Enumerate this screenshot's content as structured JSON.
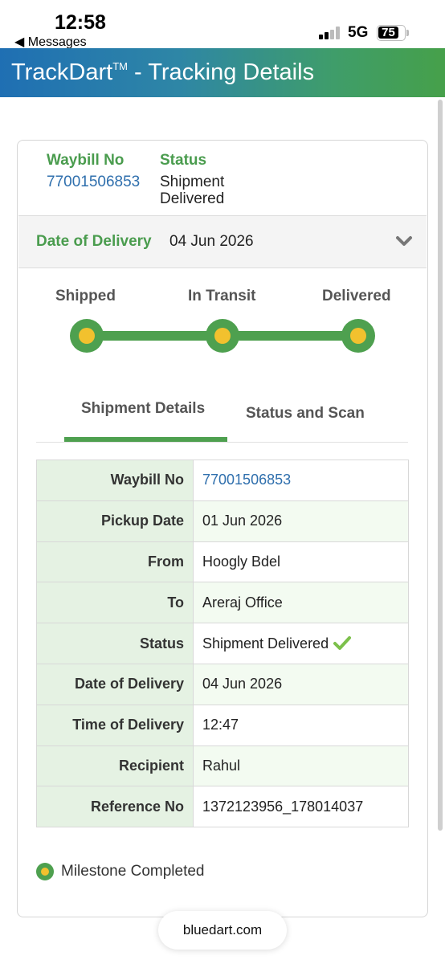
{
  "status_bar": {
    "time": "12:58",
    "back_label": "◀ Messages",
    "network": "5G",
    "battery": "75"
  },
  "header": {
    "title": "TrackDart",
    "tm": "TM",
    "title_suffix": " - Tracking Details",
    "gradient_colors": [
      "#1f6fb3",
      "#46a04a"
    ]
  },
  "summary": {
    "waybill_label": "Waybill No",
    "waybill_value": "77001506853",
    "status_label": "Status",
    "status_value": "Shipment Delivered"
  },
  "delivery_bar": {
    "label": "Date of Delivery",
    "value": "04 Jun 2026",
    "icon": "chevron-down-icon"
  },
  "milestones": [
    {
      "label": "Shipped",
      "completed": true
    },
    {
      "label": "In Transit",
      "completed": true
    },
    {
      "label": "Delivered",
      "completed": true
    }
  ],
  "tabs": {
    "active": "Shipment Details",
    "items": [
      "Shipment Details",
      "Status and Scan"
    ]
  },
  "details": [
    {
      "label": "Waybill No",
      "value": "77001506853"
    },
    {
      "label": "Pickup Date",
      "value": "01 Jun 2026"
    },
    {
      "label": "From",
      "value": "Hoogly Bdel"
    },
    {
      "label": "To",
      "value": "Areraj Office"
    },
    {
      "label": "Status",
      "value": "Shipment Delivered"
    },
    {
      "label": "Date of Delivery",
      "value": "04 Jun 2026"
    },
    {
      "label": "Time of Delivery",
      "value": "12:47"
    },
    {
      "label": "Recipient",
      "value": "Rahul"
    },
    {
      "label": "Reference No",
      "value": "1372123956_178014037"
    }
  ],
  "legend": {
    "text": "Milestone Completed"
  },
  "url_bar": {
    "domain": "bluedart.com"
  },
  "colors": {
    "accent_green": "#4ea04f",
    "milestone_yellow": "#f2c12e",
    "link_blue": "#2f6fad"
  }
}
